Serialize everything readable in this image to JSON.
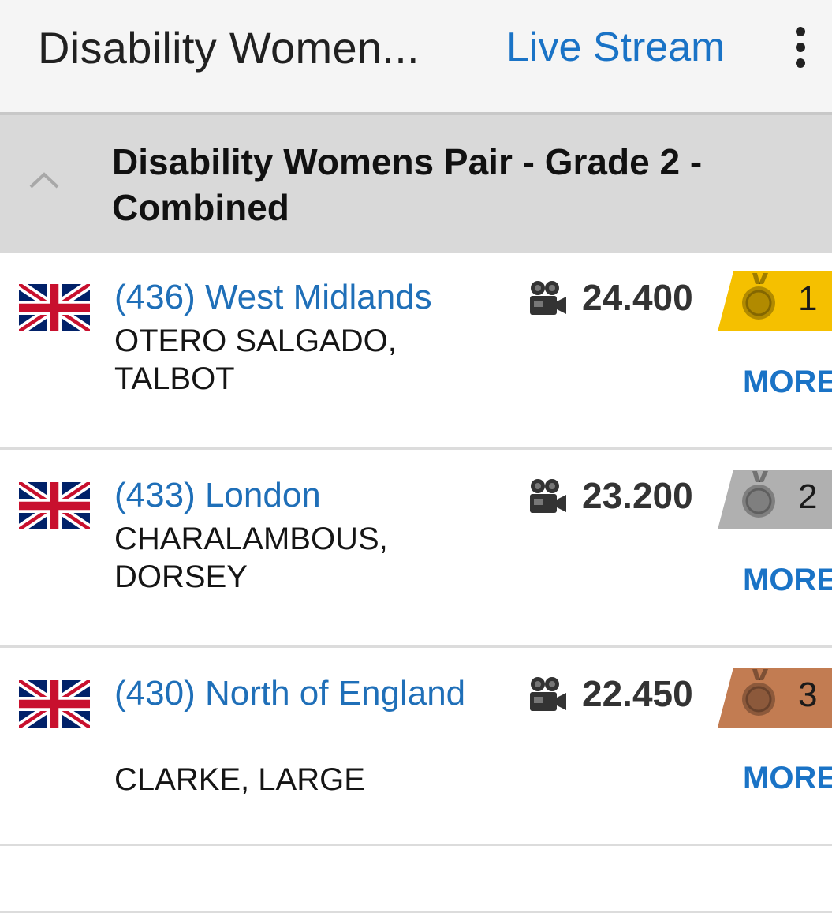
{
  "appbar": {
    "title": "Disability Women...",
    "live_stream": "Live Stream",
    "menu_icon": "more-vert-icon"
  },
  "section": {
    "title": "Disability Womens Pair - Grade 2 - Combined",
    "collapse_icon": "chevron-up-icon"
  },
  "results": [
    {
      "team": "(436) West Midlands",
      "names": "OTERO SALGADO, TALBOT",
      "score": "24.400",
      "rank": "1",
      "medal": "gold",
      "medal_color": "#f5c000",
      "more": "MORE",
      "flag_icon": "uk-flag-icon",
      "video_icon": "video-camera-icon"
    },
    {
      "team": "(433) London",
      "names": "CHARALAMBOUS, DORSEY",
      "score": "23.200",
      "rank": "2",
      "medal": "silver",
      "medal_color": "#b0b0b0",
      "more": "MORE",
      "flag_icon": "uk-flag-icon",
      "video_icon": "video-camera-icon"
    },
    {
      "team": "(430) North of England",
      "names": "CLARKE, LARGE",
      "score": "22.450",
      "rank": "3",
      "medal": "bronze",
      "medal_color": "#c27c52",
      "more": "MORE",
      "flag_icon": "uk-flag-icon",
      "video_icon": "video-camera-icon"
    }
  ]
}
